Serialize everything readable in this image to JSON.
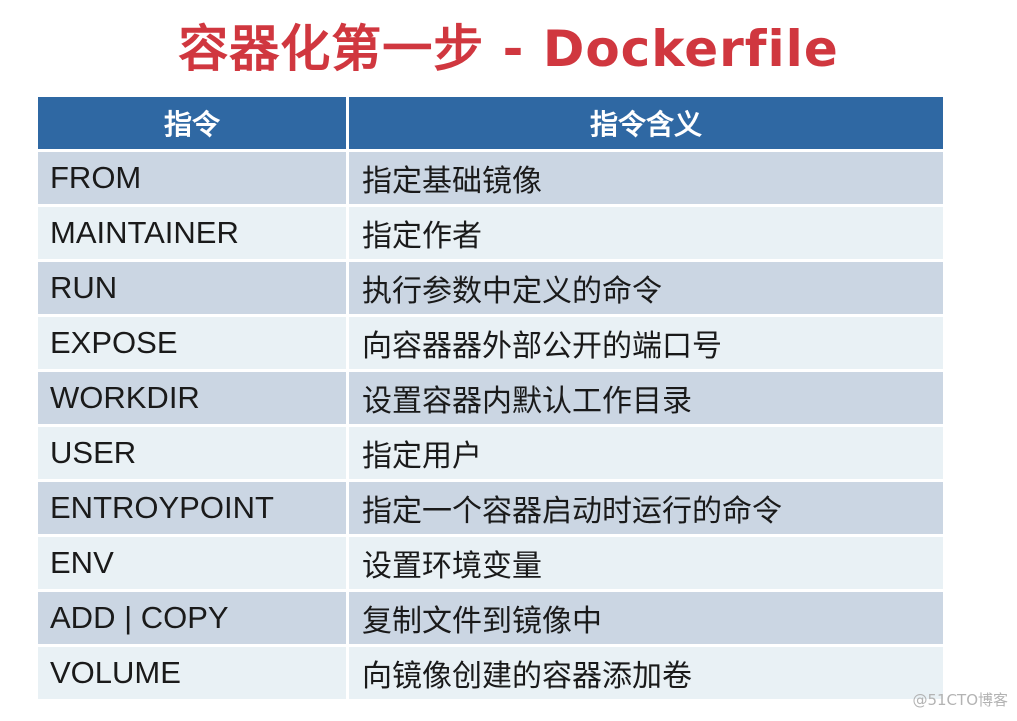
{
  "title": "容器化第一步 - Dockerfile",
  "colors": {
    "title": "#d0373f",
    "header_bg": "#2f68a3",
    "row_odd_bg": "#cbd6e3",
    "row_even_bg": "#e9f1f5"
  },
  "table": {
    "headers": [
      "指令",
      "指令含义"
    ],
    "rows": [
      {
        "instruction": "FROM",
        "meaning": "指定基础镜像"
      },
      {
        "instruction": "MAINTAINER",
        "meaning": "指定作者"
      },
      {
        "instruction": "RUN",
        "meaning": "执行参数中定义的命令"
      },
      {
        "instruction": "EXPOSE",
        "meaning": "向容器器外部公开的端口号"
      },
      {
        "instruction": "WORKDIR",
        "meaning": "设置容器内默认工作目录"
      },
      {
        "instruction": "USER",
        "meaning": "指定用户"
      },
      {
        "instruction": "ENTROYPOINT",
        "meaning": "指定一个容器启动时运行的命令"
      },
      {
        "instruction": "ENV",
        "meaning": "设置环境变量"
      },
      {
        "instruction": "ADD | COPY",
        "meaning": "复制文件到镜像中"
      },
      {
        "instruction": "VOLUME",
        "meaning": "向镜像创建的容器添加卷"
      }
    ]
  },
  "watermark": "@51CTO博客"
}
